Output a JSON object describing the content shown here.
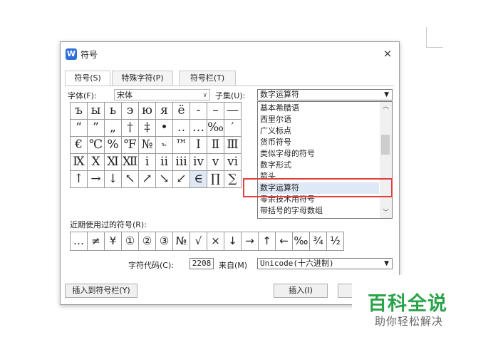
{
  "dialog": {
    "title": "符号",
    "app_icon": "wps-icon",
    "close": "×"
  },
  "tabs": [
    {
      "label": "符号(S)",
      "active": true
    },
    {
      "label": "特殊字符(P)",
      "active": false
    },
    {
      "label": "符号栏(T)",
      "active": false
    }
  ],
  "font": {
    "label": "字体(F):",
    "value": "宋体"
  },
  "subset": {
    "label": "子集(U):",
    "value": "数字运算符"
  },
  "symbol_grid": [
    [
      "ъ",
      "ы",
      "ь",
      "э",
      "ю",
      "я",
      "ё",
      "-",
      "–",
      "—"
    ],
    [
      "“",
      "”",
      "„",
      "†",
      "‡",
      "•",
      "‥",
      "…",
      "‰",
      "′"
    ],
    [
      "€",
      "℃",
      "%",
      "℉",
      "№",
      "℡",
      "™",
      "Ⅰ",
      "Ⅱ",
      "Ⅲ"
    ],
    [
      "Ⅸ",
      "Ⅹ",
      "Ⅺ",
      "Ⅻ",
      "ⅰ",
      "ⅱ",
      "ⅲ",
      "ⅳ",
      "ⅴ",
      "ⅵ"
    ],
    [
      "↑",
      "→",
      "↓",
      "↖",
      "↗",
      "↘",
      "↙",
      "∈",
      "∏",
      "∑"
    ]
  ],
  "subset_dropdown": {
    "items": [
      "基本希腊语",
      "西里尔语",
      "广义标点",
      "货币符号",
      "类似字母的符号",
      "数字形式",
      "箭头",
      "数字运算符",
      "零余技术用符号",
      "带括号的字母数组"
    ],
    "selected": "数字运算符",
    "highlight_color": "#e04040"
  },
  "recent": {
    "label": "近期使用过的符号(R):",
    "symbols": [
      "…",
      "≠",
      "¥",
      "①",
      "②",
      "③",
      "№",
      "√",
      "×",
      "↓",
      "→",
      "↑",
      "←",
      "‰",
      "¾",
      "½"
    ]
  },
  "char_code": {
    "label": "字符代码(C):",
    "value": "2208"
  },
  "from": {
    "label": "来自(M)",
    "value": "Unicode(十六进制)"
  },
  "buttons": {
    "insert_to_bar": "插入到符号栏(Y)",
    "insert": "插入(I)",
    "cancel": ""
  },
  "watermark": {
    "title": "百科全说",
    "subtitle": "助你轻松解决",
    "color": "#2aa34a"
  }
}
